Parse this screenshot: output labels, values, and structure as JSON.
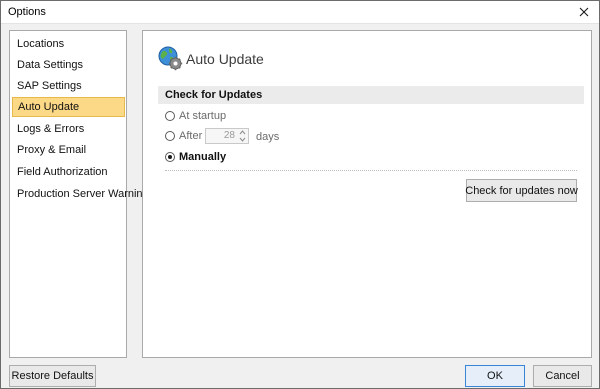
{
  "window": {
    "title": "Options"
  },
  "sidebar": {
    "items": [
      {
        "label": "Locations",
        "selected": false
      },
      {
        "label": "Data Settings",
        "selected": false
      },
      {
        "label": "SAP Settings",
        "selected": false
      },
      {
        "label": "Auto Update",
        "selected": true
      },
      {
        "label": "Logs & Errors",
        "selected": false
      },
      {
        "label": "Proxy & Email",
        "selected": false
      },
      {
        "label": "Field Authorization",
        "selected": false
      },
      {
        "label": "Production Server Warning",
        "selected": false
      }
    ]
  },
  "content": {
    "header_icon": "globe-gear-icon",
    "page_title": "Auto Update",
    "section_title": "Check for Updates",
    "options": {
      "startup": {
        "label": "At startup",
        "checked": false
      },
      "after": {
        "label": "After",
        "checked": false,
        "value": "28",
        "unit": "days"
      },
      "manually": {
        "label": "Manually",
        "checked": true
      }
    },
    "check_button": "Check for updates now"
  },
  "footer": {
    "restore_label": "Restore Defaults",
    "ok_label": "OK",
    "cancel_label": "Cancel"
  },
  "colors": {
    "selected_background": "#fcd986",
    "selected_border": "#e7b94c",
    "ok_border": "#3a84d6"
  }
}
